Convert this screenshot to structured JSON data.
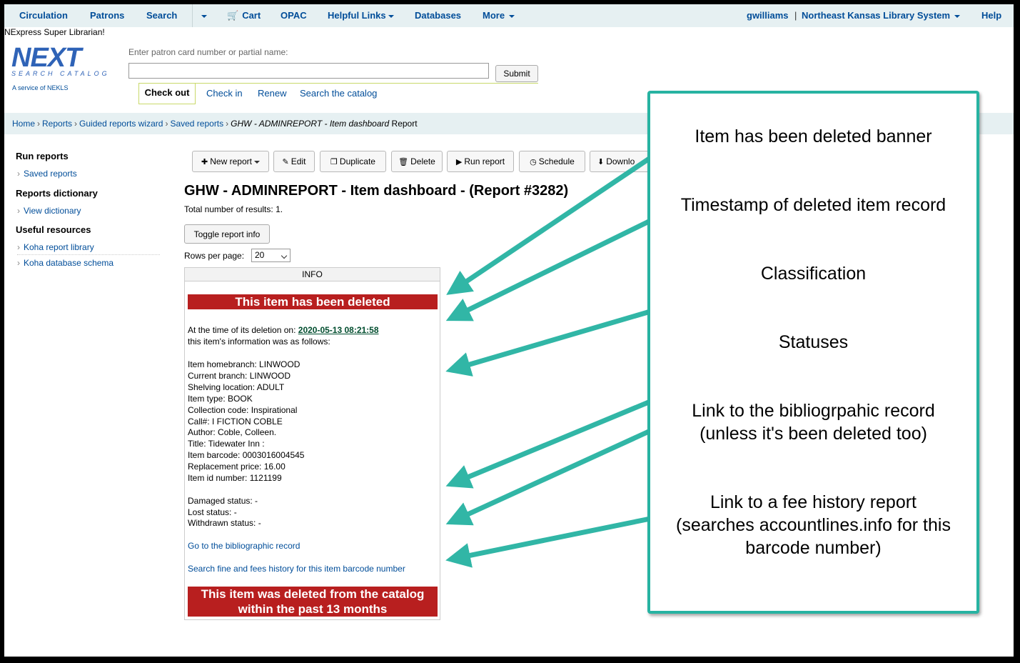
{
  "topnav": {
    "items": [
      "Circulation",
      "Patrons",
      "Search",
      "Cart",
      "OPAC",
      "Helpful Links",
      "Databases",
      "More"
    ],
    "user": "gwilliams",
    "library": "Northeast Kansas Library System",
    "help": "Help"
  },
  "logged_in_as": "NExpress Super Librarian!",
  "logo": {
    "wordmark": "NEXT",
    "subtitle": "SEARCH CATALOG",
    "tagline": "A service of NEKLS"
  },
  "checkout": {
    "label": "Enter patron card number or partial name:",
    "input_value": "",
    "submit": "Submit",
    "tabs": [
      "Check out",
      "Check in",
      "Renew",
      "Search the catalog"
    ]
  },
  "breadcrumb": {
    "items": [
      "Home",
      "Reports",
      "Guided reports wizard",
      "Saved reports"
    ],
    "current_italic": "GHW - ADMINREPORT - Item dashboard",
    "current_suffix": "Report"
  },
  "sidebar": {
    "sections": [
      {
        "title": "Run reports",
        "items": [
          "Saved reports"
        ]
      },
      {
        "title": "Reports dictionary",
        "items": [
          "View dictionary"
        ]
      },
      {
        "title": "Useful resources",
        "items": [
          "Koha report library",
          "Koha database schema"
        ]
      }
    ]
  },
  "toolbar": {
    "buttons": [
      "New report",
      "Edit",
      "Duplicate",
      "Delete",
      "Run report",
      "Schedule",
      "Downlo"
    ]
  },
  "report": {
    "title": "GHW - ADMINREPORT - Item dashboard - (Report #3282)",
    "total_label": "Total number of results:",
    "total_value": "1.",
    "toggle_button": "Toggle report info",
    "rows_per_page_label": "Rows per page:",
    "rows_per_page_value": "20"
  },
  "info": {
    "header": "INFO",
    "deleted_banner": "This item has been deleted",
    "deletion_intro": "At the time of its deletion on:",
    "deletion_timestamp": "2020-05-13 08:21:58",
    "deletion_intro2": "this item's information was as follows:",
    "fields": [
      "Item homebranch: LINWOOD",
      "Current branch: LINWOOD",
      "Shelving location: ADULT",
      "Item type: BOOK",
      "Collection code: Inspirational",
      "Call#: I FICTION COBLE",
      "Author: Coble, Colleen.",
      "Title: Tidewater Inn :",
      "Item barcode: 0003016004545",
      "Replacement price: 16.00",
      "Item id number: 1121199"
    ],
    "statuses": [
      "Damaged status: -",
      "Lost status: -",
      "Withdrawn status: -"
    ],
    "biblio_link": "Go to the bibliographic record",
    "fees_link": "Search fine and fees history for this item barcode number",
    "footer_banner_line1": "This item was deleted from the catalog",
    "footer_banner_line2": "within the past 13 months"
  },
  "callout": {
    "notes": [
      "Item has been deleted banner",
      "Timestamp of deleted item record",
      "Classification",
      "Statuses",
      "Link to the bibliogrpahic record\n(unless it's been deleted too)",
      "Link to a fee history report\n(searches accountlines.info for this\nbarcode number)"
    ]
  },
  "colors": {
    "link": "#004d99",
    "banner_red": "#b81f1f",
    "annotation_teal": "#27b3a2",
    "nav_bg": "#e6f0f2"
  }
}
